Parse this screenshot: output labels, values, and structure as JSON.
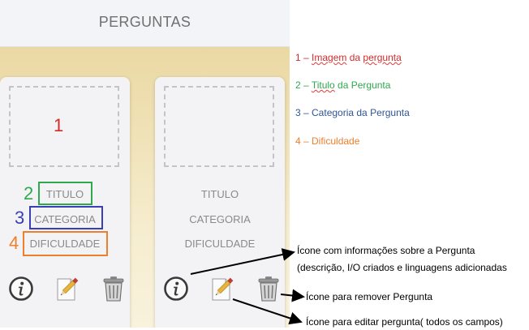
{
  "header": {
    "title": "PERGUNTAS"
  },
  "cards": [
    {
      "title": "TITULO",
      "category": "CATEGORIA",
      "difficulty": "DIFICULDADE"
    },
    {
      "title": "TITULO",
      "category": "CATEGORIA",
      "difficulty": "DIFICULDADE"
    }
  ],
  "markers": {
    "image": "1",
    "title": "2",
    "category": "3",
    "difficulty": "4"
  },
  "legend": {
    "item1": {
      "prefix": "1 – ",
      "word1": "Imagem",
      "word2": " da ",
      "word3": "pergunta"
    },
    "item2": {
      "prefix": "2 – ",
      "word1": "Titulo",
      "rest": " da Pergunta"
    },
    "item3": "3 – Categoria da Pergunta",
    "item4": "4 – Dificuldade"
  },
  "annotations": {
    "info_line1": "Ícone com informações sobre a Pergunta",
    "info_line2": "(descrição, I/O criados e linguagens adicionadas",
    "remove": "Ícone para remover Pergunta",
    "edit": "Ícone para editar pergunta( todos os campos)"
  },
  "colors": {
    "marker_image": "#d42a2a",
    "marker_title": "#2fa84f",
    "marker_category": "#3b3fb5",
    "marker_difficulty": "#ee7f2d",
    "legend_category": "#2f5597"
  }
}
